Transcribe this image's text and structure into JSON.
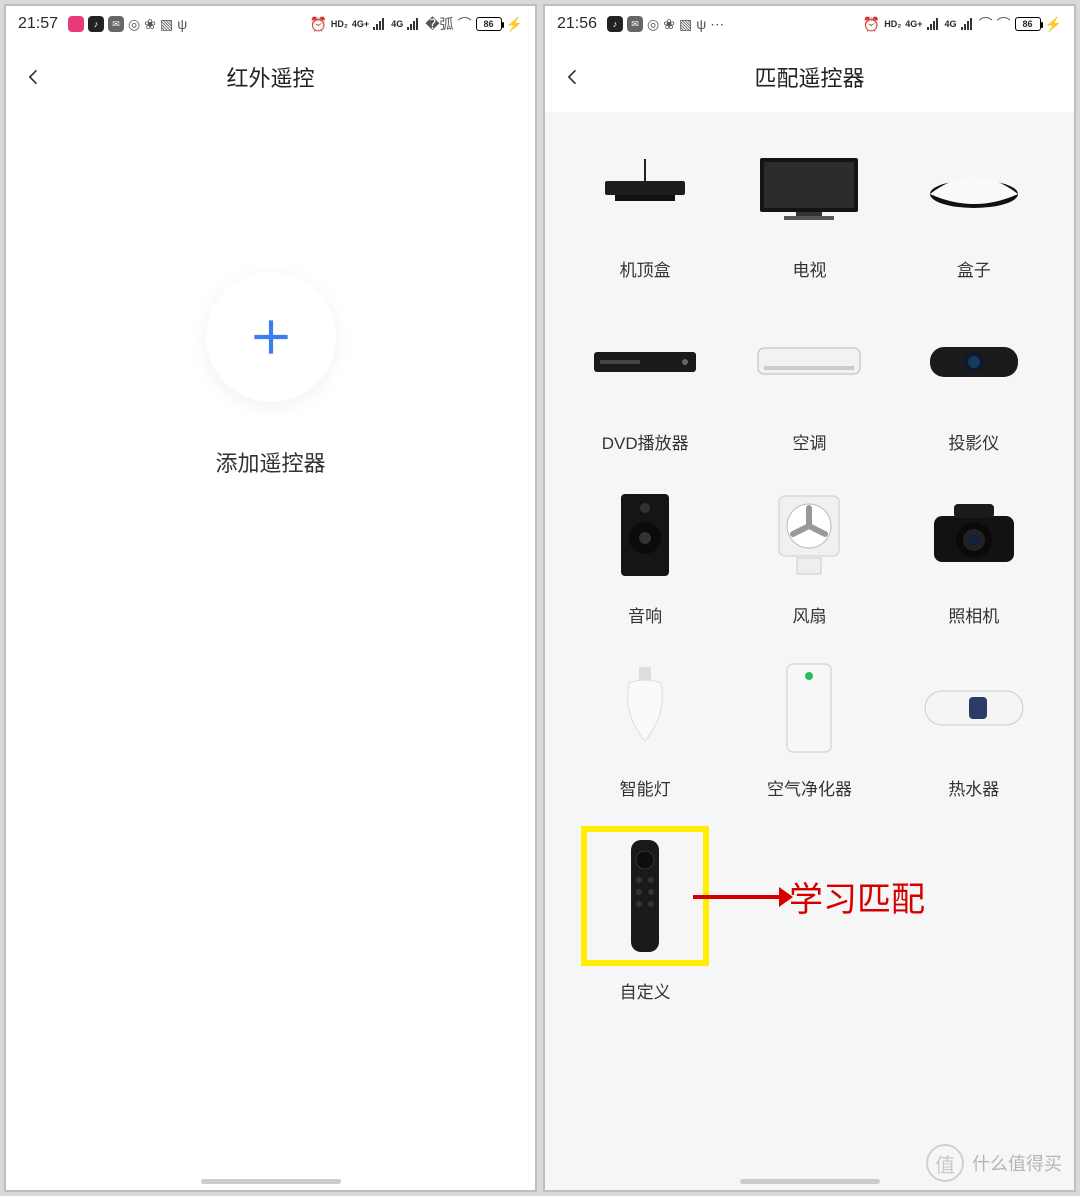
{
  "status_bar_left": {
    "time": "21:57",
    "icons": [
      "app-bili",
      "app-douyin",
      "msg",
      "netease",
      "wechat",
      "activity",
      "usb"
    ]
  },
  "status_bar_left_right": {
    "icons": [
      "alarm",
      "hd2",
      "4g1",
      "bars",
      "4g2",
      "bars",
      "wifi",
      "wifi"
    ],
    "battery": "86",
    "charging": "⚡"
  },
  "status_bar_right": {
    "time": "21:56",
    "icons": [
      "app-douyin",
      "msg",
      "netease",
      "wechat",
      "activity",
      "usb",
      "more"
    ]
  },
  "status_bar_right_right": {
    "icons": [
      "alarm",
      "hd2",
      "4g1",
      "bars",
      "4g2",
      "bars",
      "wifi",
      "wifi"
    ],
    "battery": "86",
    "charging": "⚡"
  },
  "left_screen": {
    "title": "红外遥控",
    "add_label": "添加遥控器"
  },
  "right_screen": {
    "title": "匹配遥控器",
    "grid": [
      {
        "key": "stb",
        "label": "机顶盒"
      },
      {
        "key": "tv",
        "label": "电视"
      },
      {
        "key": "box",
        "label": "盒子"
      },
      {
        "key": "dvd",
        "label": "DVD播放器"
      },
      {
        "key": "ac",
        "label": "空调"
      },
      {
        "key": "projector",
        "label": "投影仪"
      },
      {
        "key": "speaker",
        "label": "音响"
      },
      {
        "key": "fan",
        "label": "风扇"
      },
      {
        "key": "camera",
        "label": "照相机"
      },
      {
        "key": "light",
        "label": "智能灯"
      },
      {
        "key": "purifier",
        "label": "空气净化器"
      },
      {
        "key": "heater",
        "label": "热水器"
      },
      {
        "key": "custom",
        "label": "自定义",
        "highlight": true
      }
    ],
    "annotation": "学习匹配"
  },
  "watermark": {
    "symbol": "值",
    "text": "什么值得买"
  }
}
